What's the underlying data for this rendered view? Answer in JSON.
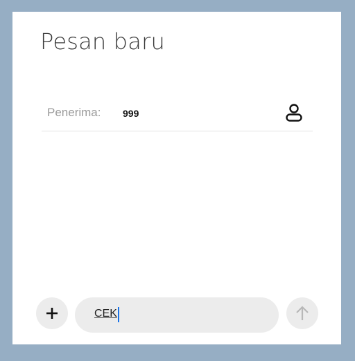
{
  "header": {
    "title": "Pesan baru"
  },
  "recipient": {
    "label": "Penerima:",
    "value": "999",
    "icon": "contact-person-icon"
  },
  "composer": {
    "add_icon": "plus-icon",
    "message_value": "CEK",
    "send_icon": "arrow-up-icon"
  },
  "colors": {
    "background": "#96aec4",
    "surface": "#ffffff",
    "input_background": "#ececec",
    "caret": "#1a73e8",
    "muted_text": "#9a9a9a",
    "disabled_icon": "#b8b8b8"
  }
}
